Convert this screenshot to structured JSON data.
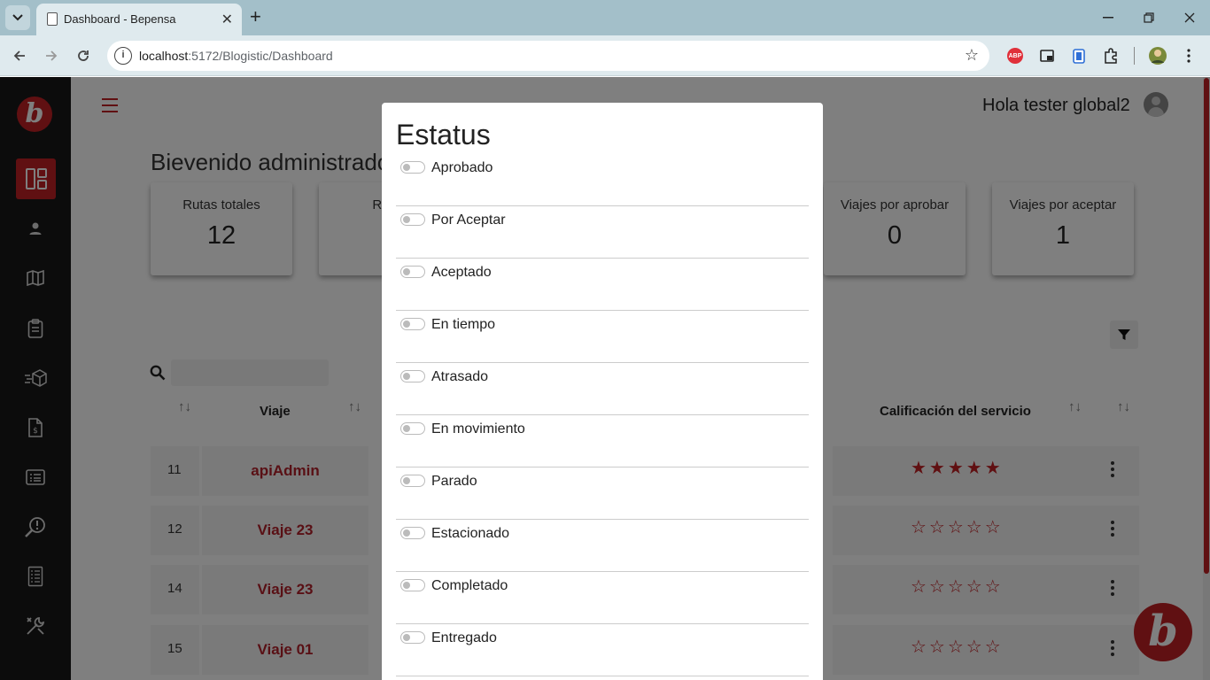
{
  "browser": {
    "tab_title": "Dashboard - Bepensa",
    "url_host": "localhost",
    "url_path": ":5172/Blogistic/Dashboard",
    "ext_abp_label": "ABP"
  },
  "header": {
    "greeting": "Hola tester global2"
  },
  "welcome": "Bievenido administrador de",
  "cards": [
    {
      "label": "Rutas totales",
      "value": "12"
    },
    {
      "label": "Rutas",
      "value": ""
    },
    {
      "label": "Viajes por aprobar",
      "value": "0"
    },
    {
      "label": "Viajes por aceptar",
      "value": "1"
    }
  ],
  "table": {
    "headers": {
      "trip": "Viaje",
      "rating": "Calificación del servicio"
    },
    "rows": [
      {
        "num": "11",
        "name": "apiAdmin",
        "stars": "★★★★★",
        "rating": 5
      },
      {
        "num": "12",
        "name": "Viaje 23",
        "stars": "☆☆☆☆☆",
        "rating": 0
      },
      {
        "num": "14",
        "name": "Viaje 23",
        "stars": "☆☆☆☆☆",
        "rating": 0
      },
      {
        "num": "15",
        "name": "Viaje 01",
        "stars": "☆☆☆☆☆",
        "rating": 0
      }
    ]
  },
  "modal": {
    "title": "Estatus",
    "options": [
      {
        "label": "Aprobado",
        "on": false
      },
      {
        "label": "Por Aceptar",
        "on": false
      },
      {
        "label": "Aceptado",
        "on": false
      },
      {
        "label": "En tiempo",
        "on": false
      },
      {
        "label": "Atrasado",
        "on": false
      },
      {
        "label": "En movimiento",
        "on": false
      },
      {
        "label": "Parado",
        "on": false
      },
      {
        "label": "Estacionado",
        "on": false
      },
      {
        "label": "Completado",
        "on": false
      },
      {
        "label": "Entregado",
        "on": false
      }
    ]
  },
  "colors": {
    "brand": "#c12025",
    "sidebar": "#181818"
  },
  "icons": {
    "sidebar": [
      "dashboard-icon",
      "user-icon",
      "map-icon",
      "clipboard-icon",
      "package-icon",
      "invoice-icon",
      "list-icon",
      "search-alert-icon",
      "report-icon",
      "tools-icon"
    ]
  }
}
